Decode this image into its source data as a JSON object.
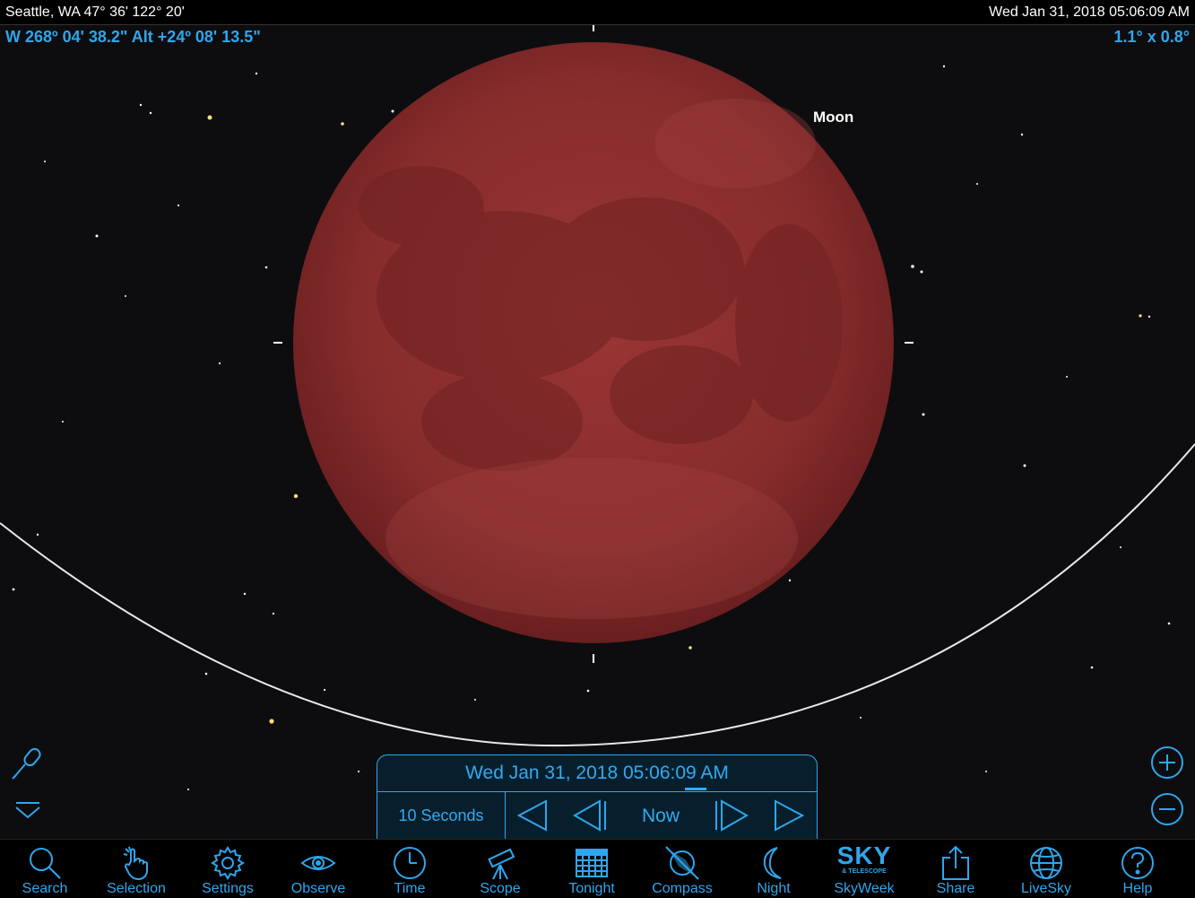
{
  "status_bar": {
    "location": "Seattle, WA  47° 36' 122° 20'",
    "datetime": "Wed Jan 31, 2018  05:06:09 AM"
  },
  "overlay": {
    "coordinates": "W 268º 04' 38.2\" Alt +24º 08' 13.5\"",
    "field_of_view": "1.1° x  0.8°",
    "object_label": "Moon"
  },
  "colors": {
    "accent": "#2fa6ec",
    "moon": "#8a2c2c",
    "background": "#0d0d0f"
  },
  "time_panel": {
    "display": "Wed Jan 31, 2018   05:06:09 AM",
    "step": "10 Seconds",
    "now_label": "Now"
  },
  "toolbar": {
    "items": [
      {
        "label": "Search",
        "icon": "search-icon"
      },
      {
        "label": "Selection",
        "icon": "selection-hand-icon"
      },
      {
        "label": "Settings",
        "icon": "gear-icon"
      },
      {
        "label": "Observe",
        "icon": "eye-icon"
      },
      {
        "label": "Time",
        "icon": "clock-icon"
      },
      {
        "label": "Scope",
        "icon": "telescope-icon"
      },
      {
        "label": "Tonight",
        "icon": "calendar-grid-icon"
      },
      {
        "label": "Compass",
        "icon": "compass-icon"
      },
      {
        "label": "Night",
        "icon": "crescent-moon-icon"
      },
      {
        "label": "SkyWeek",
        "icon": "sky-telescope-logo-icon"
      },
      {
        "label": "Share",
        "icon": "share-icon"
      },
      {
        "label": "LiveSky",
        "icon": "globe-icon"
      },
      {
        "label": "Help",
        "icon": "help-icon"
      }
    ]
  },
  "skyweek_logo": {
    "main": "SKY",
    "sub": "& TELESCOPE"
  }
}
